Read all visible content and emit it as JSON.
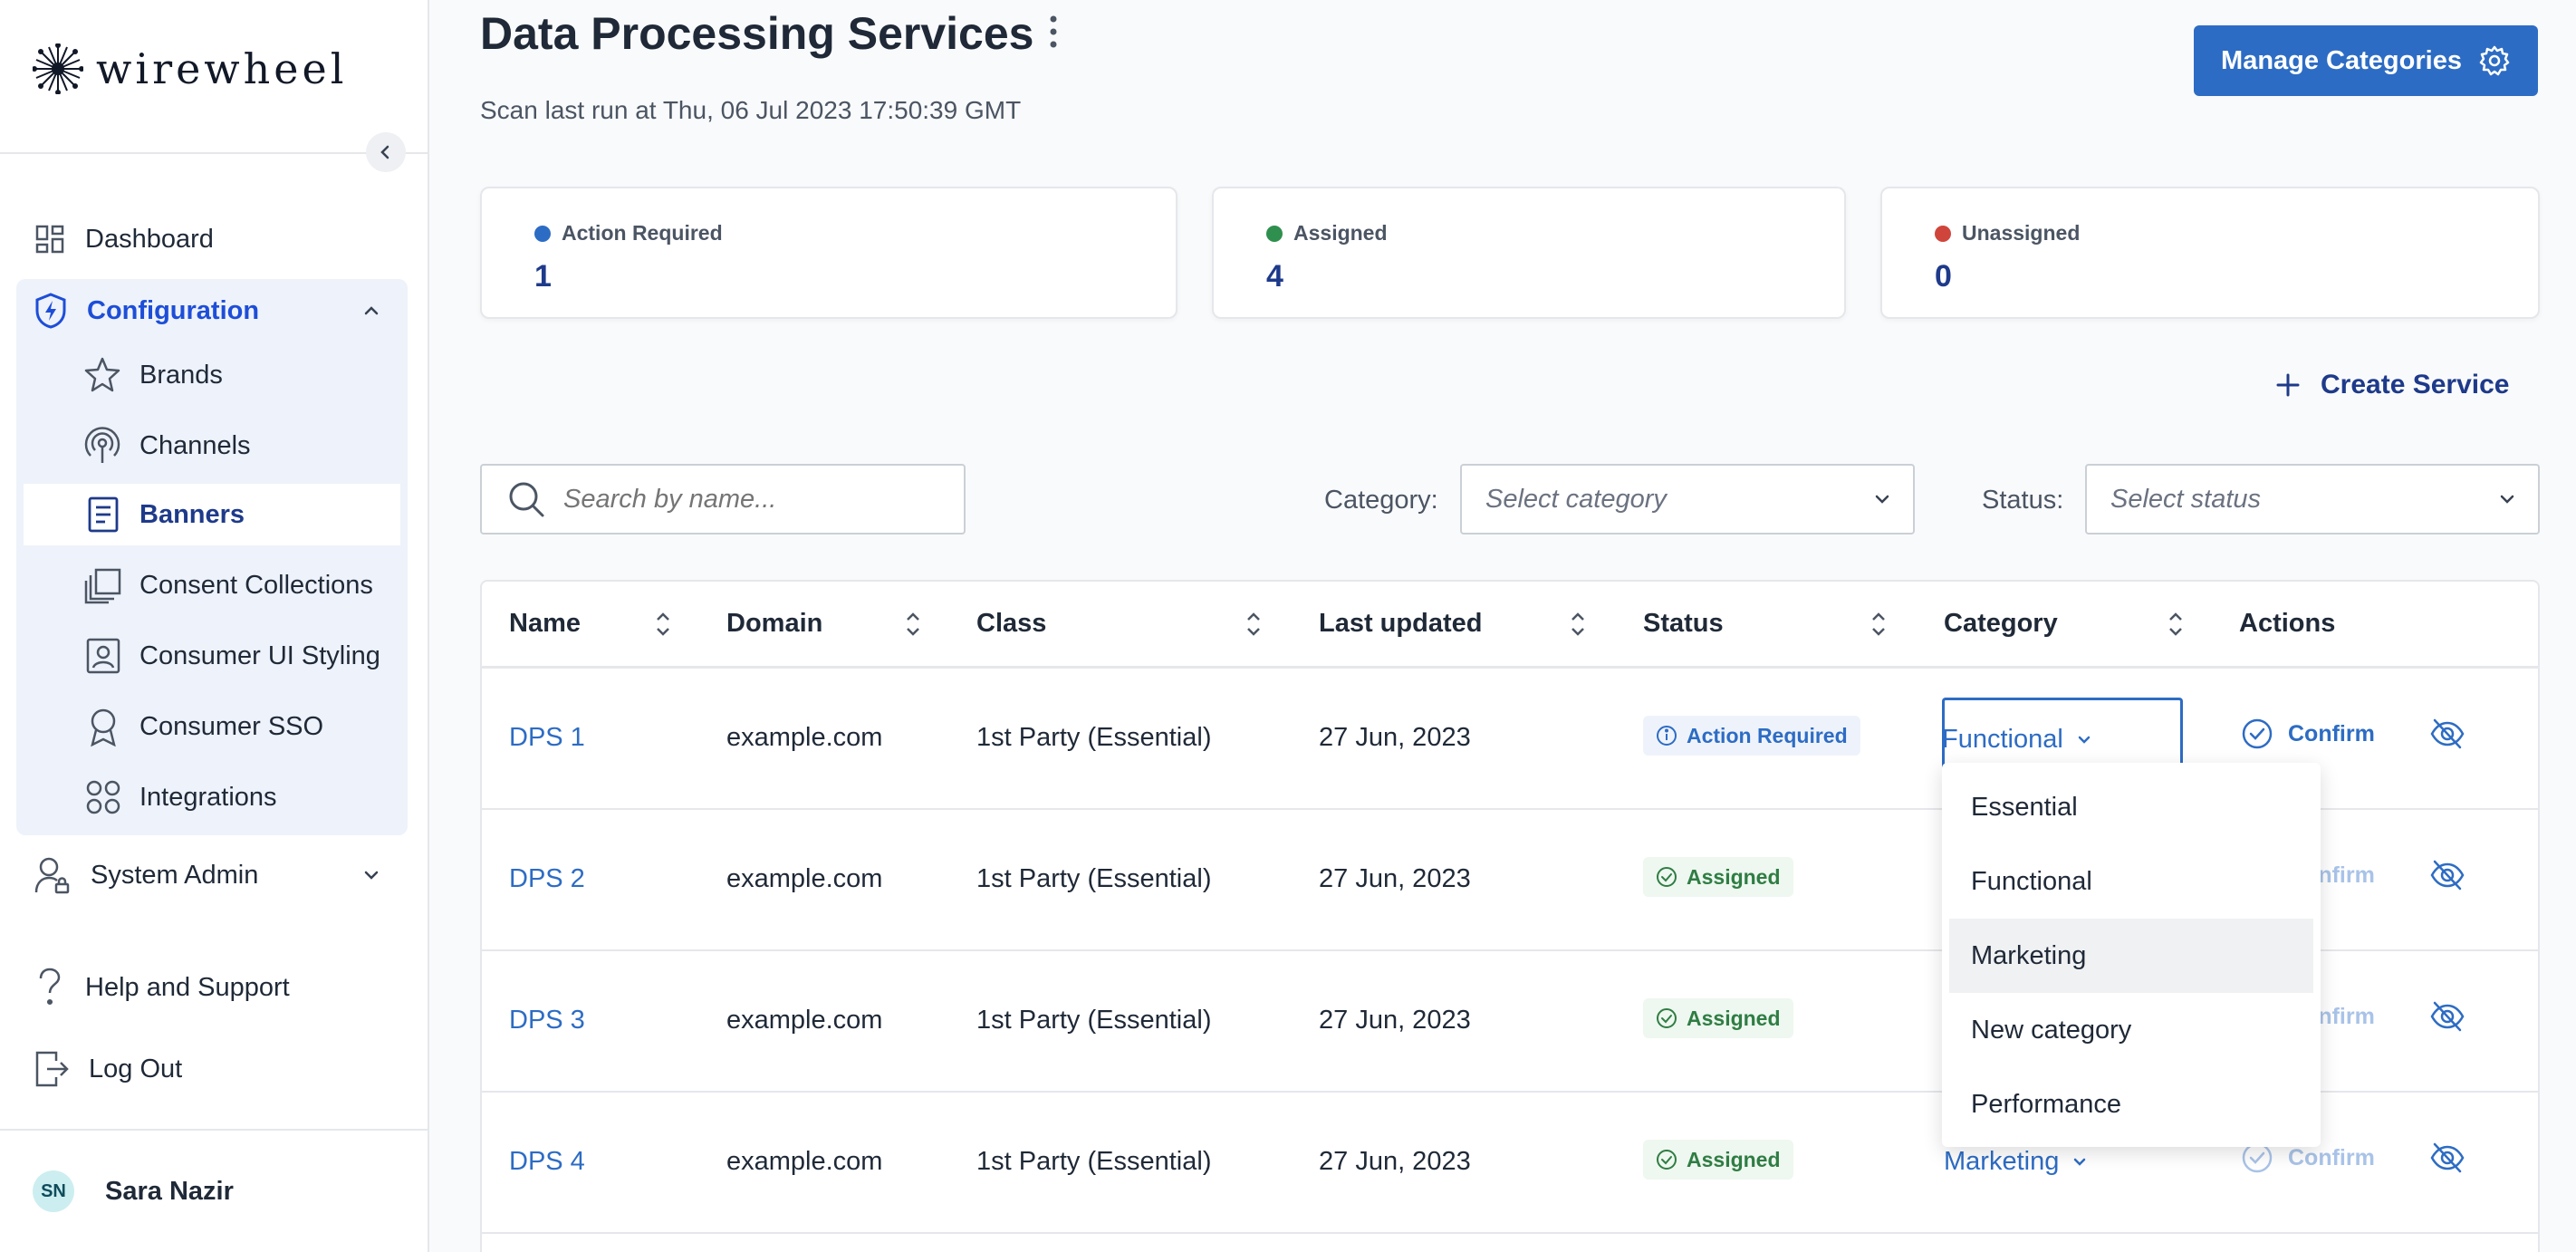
{
  "app": {
    "brand": "wirewheel"
  },
  "sidebar": {
    "dashboard": "Dashboard",
    "configuration": "Configuration",
    "config_items": [
      "Brands",
      "Channels",
      "Banners",
      "Consent Collections",
      "Consumer UI Styling",
      "Consumer SSO",
      "Integrations"
    ],
    "active_item": "Banners",
    "system_admin": "System Admin",
    "help": "Help and Support",
    "logout": "Log Out",
    "user_initials": "SN",
    "user_name": "Sara Nazir"
  },
  "header": {
    "title": "Data Processing Services",
    "scan": "Scan last run at Thu, 06 Jul 2023 17:50:39 GMT",
    "manage_categories": "Manage Categories"
  },
  "stats": [
    {
      "label": "Action Required",
      "value": "1",
      "color": "#2d6cc4"
    },
    {
      "label": "Assigned",
      "value": "4",
      "color": "#2f8f4e"
    },
    {
      "label": "Unassigned",
      "value": "0",
      "color": "#d0453b"
    }
  ],
  "create_service": "Create Service",
  "filters": {
    "search_placeholder": "Search by name...",
    "category_label": "Category:",
    "category_placeholder": "Select category",
    "status_label": "Status:",
    "status_placeholder": "Select status"
  },
  "table": {
    "columns": [
      "Name",
      "Domain",
      "Class",
      "Last updated",
      "Status",
      "Category",
      "Actions"
    ],
    "rows": [
      {
        "name": "DPS 1",
        "domain": "example.com",
        "class": "1st Party (Essential)",
        "updated": "27 Jun, 2023",
        "status": "Action Required",
        "category": "Functional",
        "action": "Confirm"
      },
      {
        "name": "DPS 2",
        "domain": "example.com",
        "class": "1st Party (Essential)",
        "updated": "27 Jun, 2023",
        "status": "Assigned",
        "category": "",
        "action": "Confirm"
      },
      {
        "name": "DPS 3",
        "domain": "example.com",
        "class": "1st Party (Essential)",
        "updated": "27 Jun, 2023",
        "status": "Assigned",
        "category": "",
        "action": "Confirm"
      },
      {
        "name": "DPS 4",
        "domain": "example.com",
        "class": "1st Party (Essential)",
        "updated": "27 Jun, 2023",
        "status": "Assigned",
        "category": "Marketing",
        "action": "Confirm"
      }
    ]
  },
  "dropdown": {
    "options": [
      "Essential",
      "Functional",
      "Marketing",
      "New category",
      "Performance"
    ],
    "hovered": "Marketing"
  }
}
